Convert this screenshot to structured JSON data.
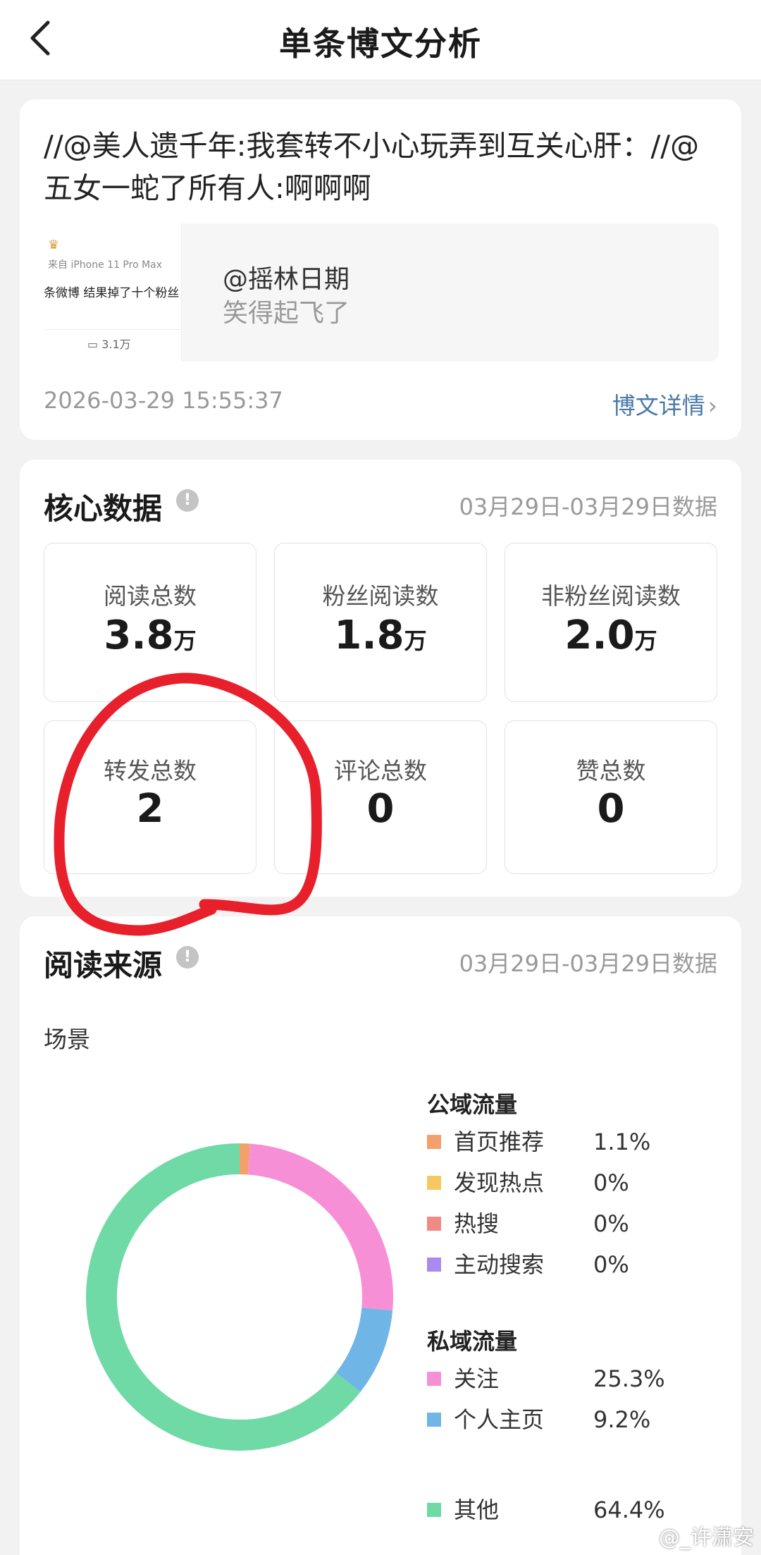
{
  "header": {
    "title": "单条博文分析"
  },
  "post": {
    "text": "//@美人遗千年:我套转不小心玩弄到互关心肝：//@五女一蛇了所有人:啊啊啊",
    "quote": {
      "thumb_source": "来自 iPhone 11 Pro Max",
      "thumb_text": "条微博 结果掉了十个粉丝",
      "thumb_count": "3.1万",
      "author": "@摇林日期",
      "content": "笑得起飞了"
    },
    "time": "2026-03-29 15:55:37",
    "detail_link": "博文详情"
  },
  "core": {
    "title": "核心数据",
    "date_range": "03月29日-03月29日数据",
    "metrics": [
      {
        "label": "阅读总数",
        "value": "3.8",
        "unit": "万"
      },
      {
        "label": "粉丝阅读数",
        "value": "1.8",
        "unit": "万"
      },
      {
        "label": "非粉丝阅读数",
        "value": "2.0",
        "unit": "万"
      },
      {
        "label": "转发总数",
        "value": "2",
        "unit": ""
      },
      {
        "label": "评论总数",
        "value": "0",
        "unit": ""
      },
      {
        "label": "赞总数",
        "value": "0",
        "unit": ""
      }
    ]
  },
  "source": {
    "title": "阅读来源",
    "date_range": "03月29日-03月29日数据",
    "scene_label": "场景",
    "public_title": "公域流量",
    "private_title": "私域流量",
    "public_items": [
      {
        "name": "首页推荐",
        "pct": "1.1%",
        "value": 1.1,
        "color": "#f4a06a"
      },
      {
        "name": "发现热点",
        "pct": "0%",
        "value": 0,
        "color": "#f6c860"
      },
      {
        "name": "热搜",
        "pct": "0%",
        "value": 0,
        "color": "#f08a84"
      },
      {
        "name": "主动搜索",
        "pct": "0%",
        "value": 0,
        "color": "#a98bf0"
      }
    ],
    "private_items": [
      {
        "name": "关注",
        "pct": "25.3%",
        "value": 25.3,
        "color": "#f78fd6"
      },
      {
        "name": "个人主页",
        "pct": "9.2%",
        "value": 9.2,
        "color": "#6fb5e6"
      }
    ],
    "other_item": {
      "name": "其他",
      "pct": "64.4%",
      "value": 64.4,
      "color": "#6fdaa6"
    }
  },
  "watermark": "@_许潇安"
}
